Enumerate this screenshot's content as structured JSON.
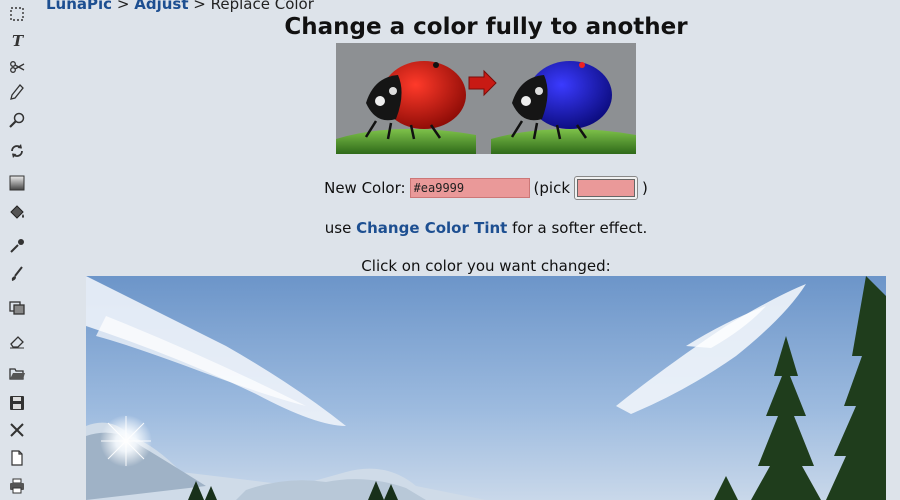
{
  "breadcrumb": {
    "home": "LunaPic",
    "sep1": ">",
    "section": "Adjust",
    "sep2": ">",
    "current": "Replace Color"
  },
  "title": "Change a color fully to another",
  "color_form": {
    "label": "New Color:",
    "value": "#ea9999",
    "pick_open": "(pick",
    "pick_close": ")",
    "swatch_color": "#ea9999"
  },
  "tint_hint": {
    "prefix": "use",
    "link": "Change Color Tint",
    "suffix": "for a softer effect."
  },
  "instruction": "Click on color you want changed:",
  "toolbar": {
    "tools": [
      "select-icon",
      "text-icon",
      "scissors-icon",
      "pencil-icon",
      "zoom-icon",
      "rotate-icon",
      "gradient-icon",
      "paint-bucket-icon",
      "eyedropper-icon",
      "brush-icon",
      "crop-icon",
      "eraser-icon",
      "open-folder-icon",
      "save-icon",
      "close-icon",
      "new-file-icon",
      "print-icon"
    ]
  }
}
